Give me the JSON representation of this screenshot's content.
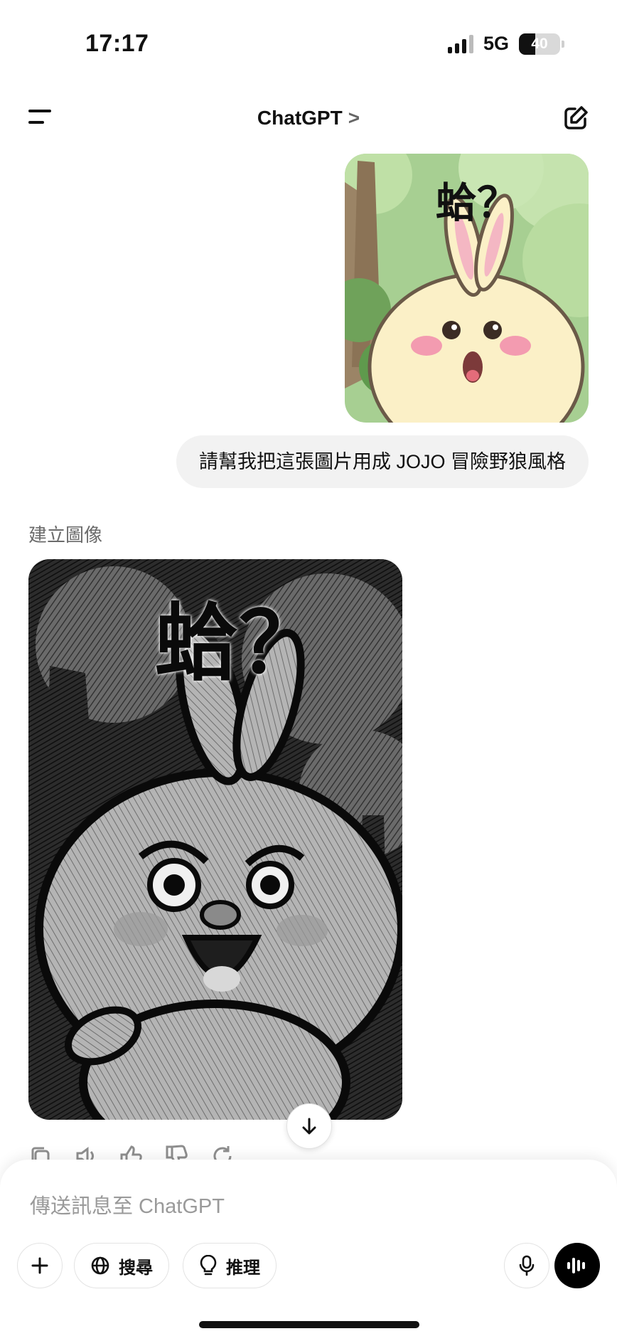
{
  "status_bar": {
    "time": "17:17",
    "network": "5G",
    "battery": "40",
    "battery_level": 0.4
  },
  "header": {
    "title": "ChatGPT",
    "chevron": ">"
  },
  "conversation": {
    "user_image_text": "蛤？",
    "user_message": "請幫我把這張圖片用成 JOJO 冒險野狼風格",
    "assistant_label": "建立圖像",
    "generated_image_text": "蛤？"
  },
  "composer": {
    "placeholder": "傳送訊息至 ChatGPT",
    "search_label": "搜尋",
    "reason_label": "推理"
  },
  "icons": {
    "menu": "menu-icon",
    "edit": "new-chat-icon",
    "scroll": "arrow-down-icon",
    "copy": "copy-icon",
    "read_aloud": "speaker-icon",
    "like": "thumbs-up-icon",
    "dislike": "thumbs-down-icon",
    "regenerate": "regenerate-icon",
    "plus": "plus-icon",
    "globe": "globe-icon",
    "bulb": "lightbulb-icon",
    "mic": "microphone-icon",
    "voice": "voice-mode-icon"
  },
  "colors": {
    "bubble": "#f2f2f2",
    "accent": "#000000",
    "muted": "#6b6b6b"
  }
}
